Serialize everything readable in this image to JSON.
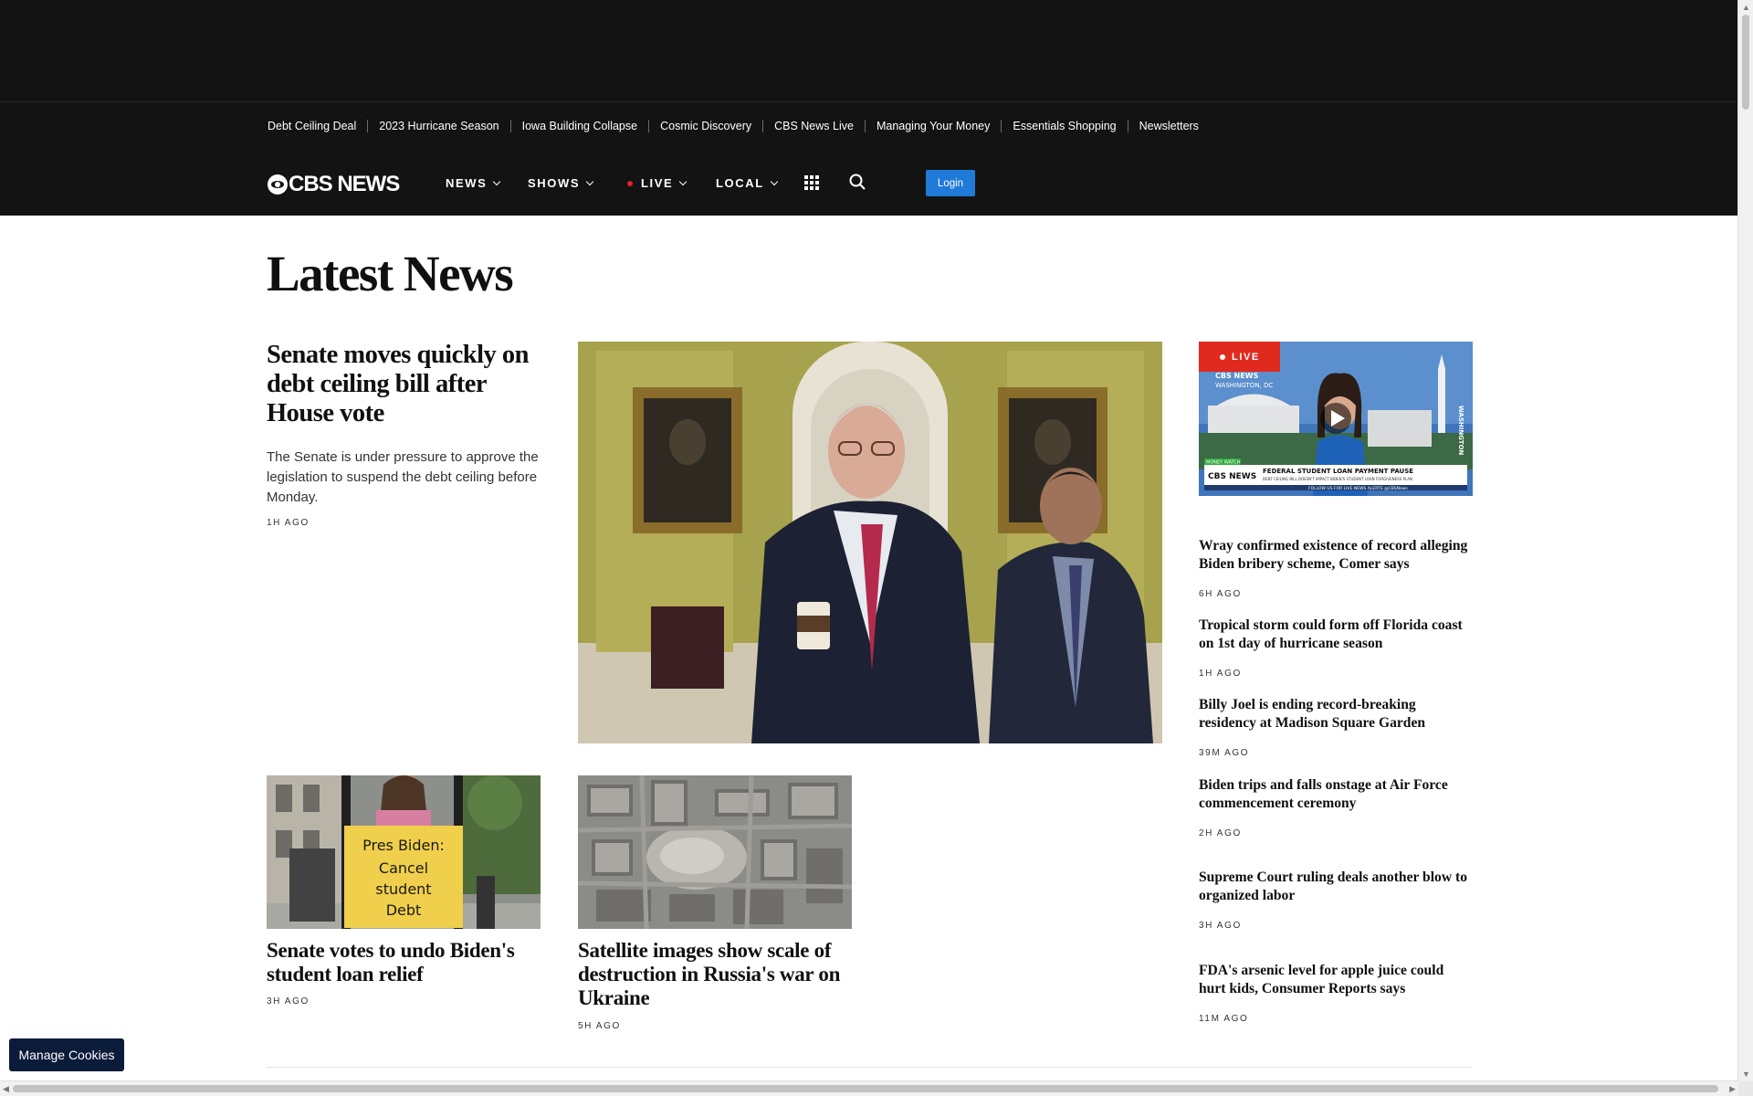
{
  "trending": [
    "Debt Ceiling Deal",
    "2023 Hurricane Season",
    "Iowa Building Collapse",
    "Cosmic Discovery",
    "CBS News Live",
    "Managing Your Money",
    "Essentials Shopping",
    "Newsletters"
  ],
  "nav": {
    "logo": "CBS NEWS",
    "news": "NEWS",
    "shows": "SHOWS",
    "live": "LIVE",
    "local": "LOCAL",
    "login": "Login",
    "icons": [
      "cbs-eye-icon",
      "chevron-down-icon",
      "live-dot-icon",
      "grid-menu-icon",
      "search-icon"
    ]
  },
  "page": {
    "title": "Latest News"
  },
  "lead": {
    "headline": "Senate moves quickly on debt ceiling bill after House vote",
    "dek": "The Senate is under pressure to approve the legislation to suspend the debt ceiling before Monday.",
    "age": "1H AGO"
  },
  "cards": [
    {
      "headline": "Senate votes to undo Biden's student loan relief",
      "age": "3H AGO",
      "sign_lines": [
        "Pres Biden:",
        "Cancel",
        "student",
        "Debt"
      ]
    },
    {
      "headline": "Satellite images show scale of destruction in Russia's war on Ukraine",
      "age": "5H AGO"
    }
  ],
  "live_video": {
    "badge": "LIVE",
    "logo": "CBS NEWS",
    "location": "WASHINGTON, DC",
    "side_label": "WASHINGTON",
    "tag": "MONEY WATCH",
    "lower_third_logo": "CBS NEWS",
    "lower_third_title": "FEDERAL STUDENT LOAN PAYMENT PAUSE",
    "lower_third_sub": "DEBT CEILING BILL DOESN'T IMPACT BIDEN'S STUDENT LOAN FORGIVENESS PLAN",
    "ticker": "FOLLOW US FOR LIVE NEWS ALERTS @CBSNews"
  },
  "sidebar": [
    {
      "headline": "Wray confirmed existence of record alleging Biden bribery scheme, Comer says",
      "age": "6H AGO"
    },
    {
      "headline": "Tropical storm could form off Florida coast on 1st day of hurricane season",
      "age": "1H AGO"
    },
    {
      "headline": "Billy Joel is ending record-breaking residency at Madison Square Garden",
      "age": "39M AGO"
    },
    {
      "headline": "Biden trips and falls onstage at Air Force commencement ceremony",
      "age": "2H AGO"
    },
    {
      "headline": "Supreme Court ruling deals another blow to organized labor",
      "age": "3H AGO"
    },
    {
      "headline": "FDA's arsenic level for apple juice could hurt kids, Consumer Reports says",
      "age": "11M AGO"
    }
  ],
  "cookies": {
    "label": "Manage Cookies"
  },
  "colors": {
    "nav_bg": "#131313",
    "login_blue": "#1f7ad8",
    "live_red": "#e02a1e",
    "cookies_navy": "#0b1b3a"
  }
}
